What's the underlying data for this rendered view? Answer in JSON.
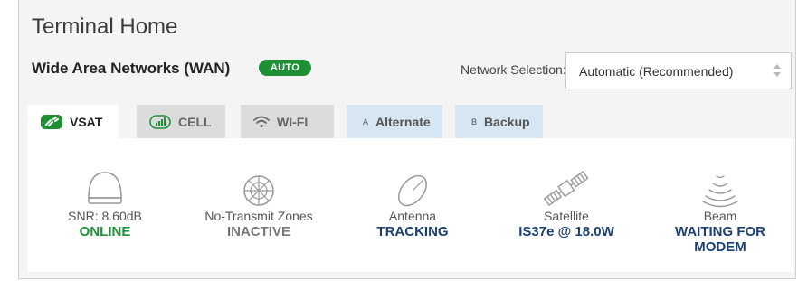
{
  "page": {
    "title": "Terminal Home"
  },
  "wan": {
    "label": "Wide Area Networks (WAN)",
    "badge": "AUTO",
    "network_selection_label": "Network Selection:",
    "network_selection_value": "Automatic (Recommended)"
  },
  "tabs": [
    {
      "label": "VSAT",
      "icon": "satellite-dish-icon",
      "active": true
    },
    {
      "label": "CELL",
      "icon": "cell-signal-icon",
      "active": false
    },
    {
      "label": "WI-FI",
      "icon": "wifi-icon",
      "active": false
    },
    {
      "label": "Alternate",
      "prefix": "A",
      "active": false
    },
    {
      "label": "Backup",
      "prefix": "B",
      "active": false
    }
  ],
  "status": {
    "snr": {
      "label": "SNR: 8.60dB",
      "value": "ONLINE",
      "icon": "dome-icon"
    },
    "zones": {
      "label": "No-Transmit Zones",
      "value": "INACTIVE",
      "icon": "globe-icon"
    },
    "antenna": {
      "label": "Antenna",
      "value": "TRACKING",
      "icon": "dish-icon"
    },
    "satellite": {
      "label": "Satellite",
      "value": "IS37e @ 18.0W",
      "icon": "satellite-icon"
    },
    "beam": {
      "label": "Beam",
      "value_line1": "WAITING FOR",
      "value_line2": "MODEM",
      "icon": "beam-icon"
    }
  },
  "colors": {
    "online": "#1e8f33",
    "inactive": "#777777",
    "status_value": "#1c3f75",
    "auto_badge": "#1e8f33",
    "tab_alt_bg": "#d6e7f3"
  }
}
